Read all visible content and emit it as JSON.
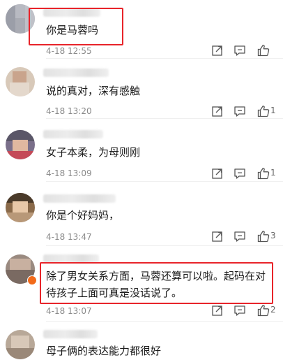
{
  "comments": [
    {
      "text": "你是马蓉吗",
      "time": "4-18 12:55",
      "likes": ""
    },
    {
      "text": "说的真对，深有感触",
      "time": "4-18 13:20",
      "likes": "1"
    },
    {
      "text": "女子本柔，为母则刚",
      "time": "4-18 13:09",
      "likes": "1"
    },
    {
      "text": "你是个好妈妈，",
      "time": "4-18 13:47",
      "likes": "3"
    },
    {
      "text_line1": "除了男女关系方面，马蓉还算可以啦。起码在对",
      "text_line2": "待孩子上面可真是没话说了。",
      "time": "4-18 13:07",
      "likes": "2"
    },
    {
      "text": "母子俩的表达能力都很好",
      "time": "",
      "likes": ""
    }
  ],
  "icons": {
    "share": "share-icon",
    "reply": "reply-icon",
    "like": "like-icon"
  },
  "colors": {
    "highlight": "#e8242a",
    "text": "#1a1a1a",
    "meta": "#8a8a8a"
  }
}
